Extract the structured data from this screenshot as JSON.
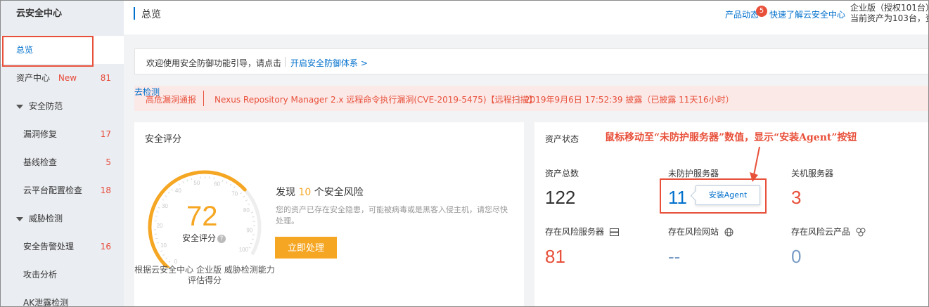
{
  "sidebar": {
    "title": "云安全中心",
    "items": [
      {
        "label": "总览"
      },
      {
        "label": "资产中心",
        "badge": "New",
        "count": "81"
      }
    ],
    "groups": [
      {
        "label": "安全防范",
        "items": [
          {
            "label": "漏洞修复",
            "count": "17"
          },
          {
            "label": "基线检查",
            "count": "5"
          },
          {
            "label": "云平台配置检查",
            "count": "18"
          }
        ]
      },
      {
        "label": "威胁检测",
        "items": [
          {
            "label": "安全告警处理",
            "count": "16"
          },
          {
            "label": "攻击分析",
            "count": ""
          },
          {
            "label": "AK泄露检测",
            "count": ""
          }
        ]
      }
    ]
  },
  "header": {
    "title": "总览",
    "product_news": "产品动态",
    "news_badge": "5",
    "quick_link": "快速了解云安全中心",
    "edition_line1": "企业版（授权101台）",
    "edition_line2": "当前资产为103台，资"
  },
  "guide": {
    "text": "欢迎使用安全防御功能引导，请点击",
    "link": "开启安全防御体系 >"
  },
  "notice": {
    "tag": "高危漏洞通报",
    "vuln": "Nexus Repository Manager 2.x 远程命令执行漏洞(CVE-2019-5475)【远程扫描】",
    "sep": "|",
    "time": "2019年9月6日 17:52:39 披露（已披露 11天16小时）",
    "action": "去检测"
  },
  "score": {
    "card_title": "安全评分",
    "value": "72",
    "label": "安全评分",
    "help": "?",
    "footer_line1": "根据云安全中心 企业版 威胁检测能力",
    "footer_line2": "评估得分",
    "risk_prefix": "发现",
    "risk_count": "10",
    "risk_suffix": "个安全风险",
    "risk_desc": "您的资产已存在安全隐患，可能被病毒或是黑客入侵主机，请您尽快处理。",
    "handle_button": "立即处理",
    "gauge_ticks": [
      "0",
      "10",
      "20",
      "30",
      "40",
      "50",
      "60",
      "70",
      "80",
      "90",
      "100"
    ],
    "gauge_fill": 0.72,
    "gauge_color": "#f5a623"
  },
  "asset": {
    "card_title": "资产状态",
    "annotation": "鼠标移动至“未防护服务器”数值，显示“安装Agent”按钮",
    "install_agent": "安装Agent",
    "stats": [
      {
        "label": "资产总数",
        "value": "122",
        "color": "#333333"
      },
      {
        "label": "未防护服务器",
        "value": "11",
        "color": "#0070cc"
      },
      {
        "label": "关机服务器",
        "value": "3",
        "color": "#e8503a"
      },
      {
        "label": "存在风险服务器",
        "value": "81",
        "color": "#e8503a",
        "icon": "server-icon"
      },
      {
        "label": "存在风险网站",
        "value": "--",
        "color": "#7a9cc6",
        "icon": "globe-icon"
      },
      {
        "label": "存在风险云产品",
        "value": "0",
        "color": "#7a9cc6",
        "icon": "cloud-nodes-icon"
      }
    ]
  },
  "colors": {
    "accent": "#0070cc",
    "danger": "#e8503a",
    "warning": "#f5a623"
  }
}
